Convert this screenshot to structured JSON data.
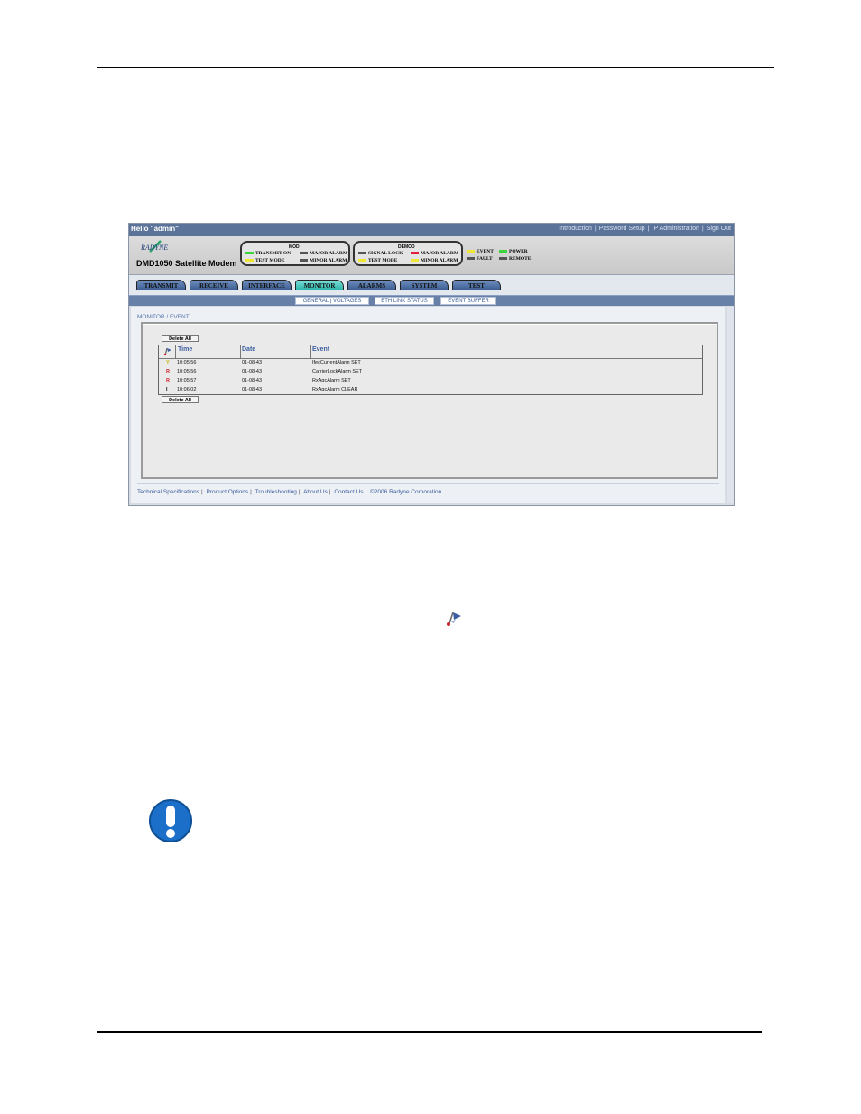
{
  "screenshot": {
    "greeting": "Hello \"admin\"",
    "top_links": [
      "Introduction",
      "Password Setup",
      "IP Administration",
      "Sign Out"
    ],
    "logo_text": "RADYNE",
    "model": "DMD1050 Satellite Modem",
    "mod_group": {
      "title": "MOD",
      "leds": [
        {
          "label": "TRANSMIT ON",
          "color": "#3bd43b"
        },
        {
          "label": "MAJOR ALARM",
          "color": "#555555"
        },
        {
          "label": "TEST MODE",
          "color": "#f2e634"
        },
        {
          "label": "MINOR ALARM",
          "color": "#555555"
        }
      ]
    },
    "demod_group": {
      "title": "DEMOD",
      "leds": [
        {
          "label": "SIGNAL LOCK",
          "color": "#555555"
        },
        {
          "label": "MAJOR ALARM",
          "color": "#e0203c"
        },
        {
          "label": "TEST MODE",
          "color": "#f2e634"
        },
        {
          "label": "MINOR ALARM",
          "color": "#f2e634"
        }
      ]
    },
    "status_leds": [
      {
        "label": "EVENT",
        "color": "#f2e634"
      },
      {
        "label": "POWER",
        "color": "#3bd43b"
      },
      {
        "label": "FAULT",
        "color": "#555555"
      },
      {
        "label": "REMOTE",
        "color": "#555555"
      }
    ],
    "tabs": [
      "TRANSMIT",
      "RECEIVE",
      "INTERFACE",
      "MONITOR",
      "ALARMS",
      "SYSTEM",
      "TEST"
    ],
    "active_tab": "MONITOR",
    "subtabs": [
      "GENERAL | VOLTAGES",
      "ETH LINK STATUS",
      "EVENT BUFFER"
    ],
    "breadcrumb": "MONITOR / EVENT",
    "delete_all": "Delete All",
    "columns": [
      "Time",
      "Date",
      "Event"
    ],
    "rows": [
      {
        "sev": "Y",
        "sev_color": "#c8b400",
        "time": "10:05:56",
        "date": "01-08-43",
        "event": "IfecCurrentAlarm SET"
      },
      {
        "sev": "R",
        "sev_color": "#d0202a",
        "time": "10:05:56",
        "date": "01-08-43",
        "event": "CarrierLockAlarm SET"
      },
      {
        "sev": "R",
        "sev_color": "#d0202a",
        "time": "10:05:57",
        "date": "01-08-43",
        "event": "RxAgcAlarm SET"
      },
      {
        "sev": "I",
        "sev_color": "#111111",
        "time": "10:06:02",
        "date": "01-08-43",
        "event": "RxAgcAlarm CLEAR"
      }
    ],
    "footer_links": [
      "Technical Specifications",
      "Product Options",
      "Troubleshooting",
      "About Us",
      "Contact Us",
      "©2006 Radyne Corporation"
    ]
  }
}
